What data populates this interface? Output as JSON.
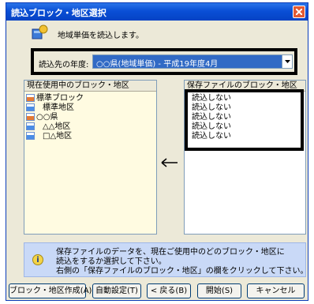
{
  "window": {
    "title": "読込ブロック・地区選択"
  },
  "header": {
    "message": "地域単価を読込します。"
  },
  "year": {
    "label": "読込先の年度:",
    "selected": "○○県(地域単価) - 平成19年度4月"
  },
  "left_panel": {
    "header": "現在使用中のブロック・地区",
    "items": [
      {
        "label": "標準ブロック",
        "indent": 0
      },
      {
        "label": "標準地区",
        "indent": 1
      },
      {
        "label": "○○県",
        "indent": 0
      },
      {
        "label": "△△地区",
        "indent": 1
      },
      {
        "label": "□△地区",
        "indent": 1
      }
    ]
  },
  "right_panel": {
    "header": "保存ファイルのブロック・地区",
    "items": [
      "読込しない",
      "読込しない",
      "読込しない",
      "読込しない",
      "読込しない"
    ]
  },
  "arrow": "←",
  "info": {
    "lines": [
      "保存ファイルのデータを、現在ご使用中のどのブロック・地区に",
      "読込をするか選択して下さい。",
      "右側の「保存ファイルのブロック・地区」の欄をクリックして下さい。"
    ]
  },
  "buttons": {
    "create_block": "ブロック・地区作成(A)...",
    "auto_setup": "自動設定(T)",
    "back": "< 戻る(B)",
    "start": "開始(S)",
    "cancel": "キャンセル"
  }
}
